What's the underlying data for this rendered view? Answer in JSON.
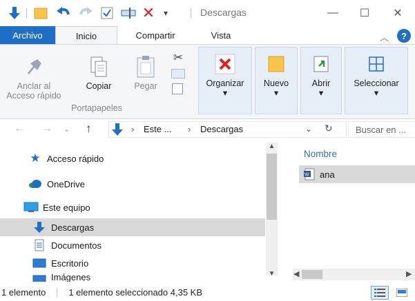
{
  "window": {
    "title": "Descargas",
    "minimize_glyph": "—",
    "maximize_glyph": "☐",
    "close_glyph": "✕"
  },
  "tabs": [
    "Archivo",
    "Inicio",
    "Compartir",
    "Vista"
  ],
  "ribbon": {
    "pin_label_1": "Anclar al",
    "pin_label_2": "Acceso rápido",
    "copy_label": "Copiar",
    "paste_label": "Pegar",
    "group_label": "Portapapeles",
    "organize_label": "Organizar",
    "new_label": "Nuevo",
    "open_label": "Abrir",
    "select_label": "Seleccionar",
    "caret": "▾"
  },
  "address": {
    "path_ellipsis": "Este ...",
    "path_current": "Descargas",
    "chevron": "›",
    "search_placeholder": "Buscar en ..."
  },
  "tree": [
    {
      "label": "Acceso rápido"
    },
    {
      "label": "OneDrive"
    },
    {
      "label": "Este equipo"
    },
    {
      "label": "Descargas"
    },
    {
      "label": "Documentos"
    },
    {
      "label": "Escritorio"
    },
    {
      "label": "Imágenes"
    }
  ],
  "list": {
    "column_header": "Nombre",
    "files": [
      {
        "name": "ana"
      }
    ]
  },
  "status": {
    "count": "1 elemento",
    "selected": "1 elemento seleccionado  4,35 KB"
  },
  "colors": {
    "accent": "#1f6fc8",
    "selected_bg": "#d9d9d9"
  }
}
